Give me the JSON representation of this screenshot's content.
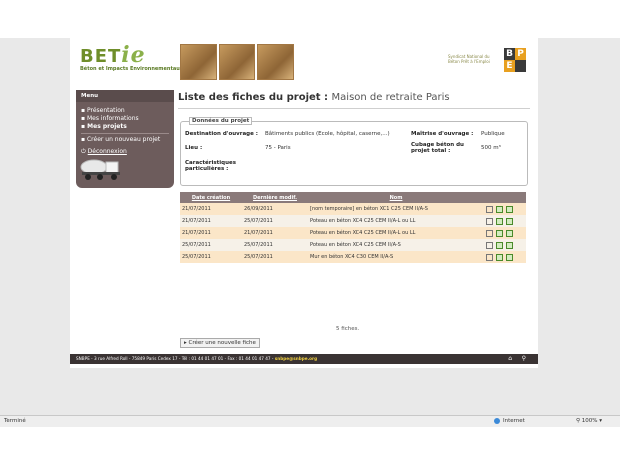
{
  "header": {
    "logo_main": "BET",
    "logo_italic": "ie",
    "logo_sub": "Béton et Impacts Environnementaux",
    "syndicat_line1": "Syndicat National du",
    "syndicat_line2": "Béton Prêt à l'Emploi",
    "bpe_letters": [
      "B",
      "P",
      "E",
      ""
    ]
  },
  "sidebar": {
    "title": "Menu",
    "items": [
      {
        "label": "Présentation"
      },
      {
        "label": "Mes informations"
      },
      {
        "label": "Mes projets",
        "active": true
      },
      {
        "label": "Créer un nouveau projet"
      },
      {
        "label": "Déconnexion"
      }
    ]
  },
  "main": {
    "title_prefix": "Liste des fiches du projet :",
    "project_name": "Maison de retraite Paris",
    "fieldset_legend": "Données du projet",
    "destination_label": "Destination d'ouvrage :",
    "destination_value": "Bâtiments publics (Ecole, hôpital, caserne,...)",
    "lieu_label": "Lieu :",
    "lieu_value": "75 - Paris",
    "caract_label_1": "Caractéristiques",
    "caract_label_2": "particulières :",
    "maitrise_label": "Maîtrise d'ouvrage :",
    "maitrise_value": "Publique",
    "cubage_label_1": "Cubage béton du",
    "cubage_label_2": "projet total :",
    "cubage_value": "500 m³",
    "columns": [
      "Date création",
      "Dernière modif.",
      "Nom",
      ""
    ],
    "rows": [
      {
        "created": "21/07/2011",
        "modified": "26/09/2011",
        "name": "[nom temporaire] en béton XC1 C25 CEM II/A-S"
      },
      {
        "created": "21/07/2011",
        "modified": "25/07/2011",
        "name": "Poteau en béton XC4 C25 CEM II/A-L ou LL"
      },
      {
        "created": "21/07/2011",
        "modified": "21/07/2011",
        "name": "Poteau en béton XC4 C25 CEM II/A-L ou LL"
      },
      {
        "created": "25/07/2011",
        "modified": "25/07/2011",
        "name": "Poteau en béton XC4 C25 CEM II/A-S"
      },
      {
        "created": "25/07/2011",
        "modified": "25/07/2011",
        "name": "Mur en béton XC4 C30 CEM II/A-S"
      }
    ],
    "count_text": "5 fiches.",
    "new_button": "Créer une nouvelle fiche"
  },
  "footer": {
    "text": "SNBPE - 3 rue Alfred Roll - 75849 Paris Cedex 17 - Tél : 01 44 01 47 01 - Fax : 01 44 01 47 47 - ",
    "email": "snbpe@snbpe.org"
  },
  "statusbar": {
    "left": "Terminé",
    "zone": "Internet",
    "zoom": "100%"
  },
  "colors": {
    "brand_green": "#6f8e2a",
    "menu_bg": "#6d5c5c",
    "row_highlight": "#fbe6c8"
  }
}
